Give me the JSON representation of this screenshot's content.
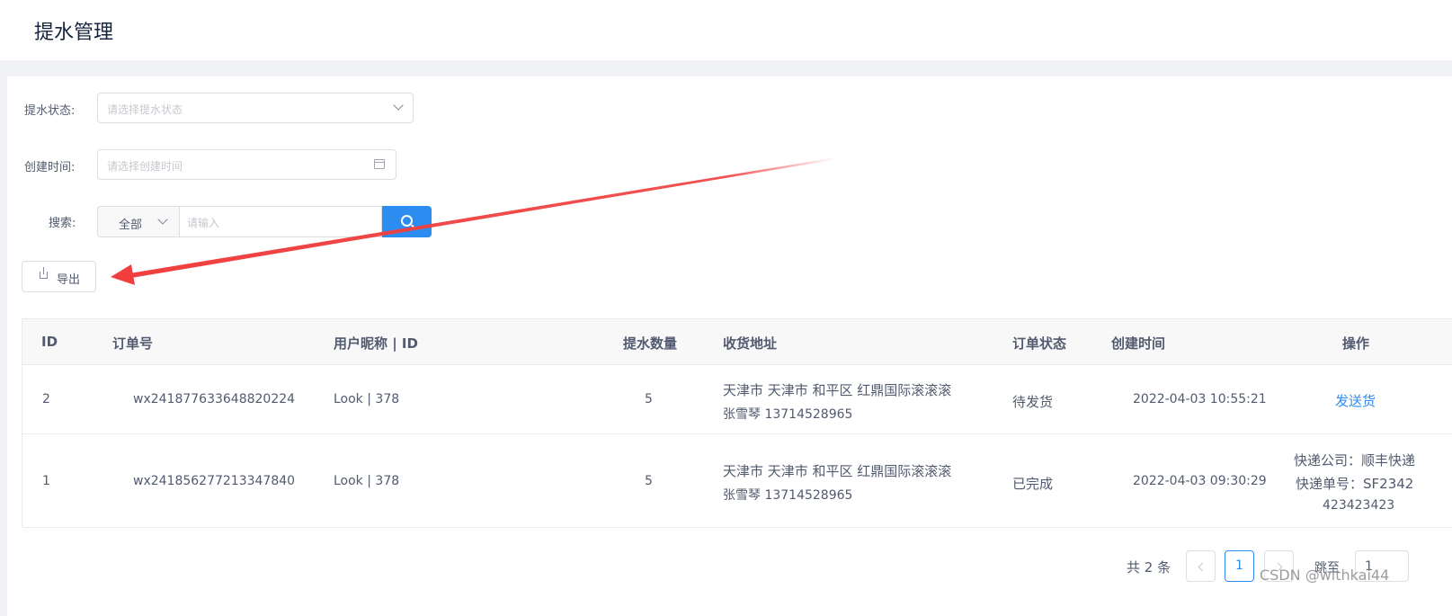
{
  "page": {
    "title": "提水管理"
  },
  "filters": {
    "status_label": "提水状态:",
    "status_placeholder": "请选择提水状态",
    "created_label": "创建时间:",
    "created_placeholder": "请选择创建时间",
    "search_label": "搜索:",
    "search_scope": "全部",
    "search_placeholder": "请输入"
  },
  "toolbar": {
    "export_label": "导出"
  },
  "table": {
    "columns": [
      "ID",
      "订单号",
      "用户昵称 | ID",
      "提水数量",
      "收货地址",
      "订单状态",
      "创建时间",
      "操作"
    ],
    "rows": [
      {
        "id": "2",
        "order_no": "wx241877633648820224",
        "user": "Look | 378",
        "quantity": "5",
        "address_line1": "天津市 天津市 和平区 红鼎国际滚滚滚",
        "address_line2": "张雪琴   13714528965",
        "status": "待发货",
        "created": "2022-04-03 10:55:21",
        "action": "发送货"
      },
      {
        "id": "1",
        "order_no": "wx241856277213347840",
        "user": "Look | 378",
        "quantity": "5",
        "address_line1": "天津市 天津市 和平区 红鼎国际滚滚滚",
        "address_line2": "张雪琴   13714528965",
        "status": "已完成",
        "created": "2022-04-03 09:30:29",
        "shipping_company": "快递公司：顺丰快递",
        "tracking_no": "快递单号：SF2342",
        "tracking_no_cont": "423423423"
      }
    ]
  },
  "pagination": {
    "total": "共 2 条",
    "current": "1",
    "jump_label": "跳至",
    "jump_value": "1"
  },
  "watermark": "CSDN @withkai44",
  "colors": {
    "primary": "#2d8cf0",
    "annotation_arrow": "#f03e3e"
  }
}
